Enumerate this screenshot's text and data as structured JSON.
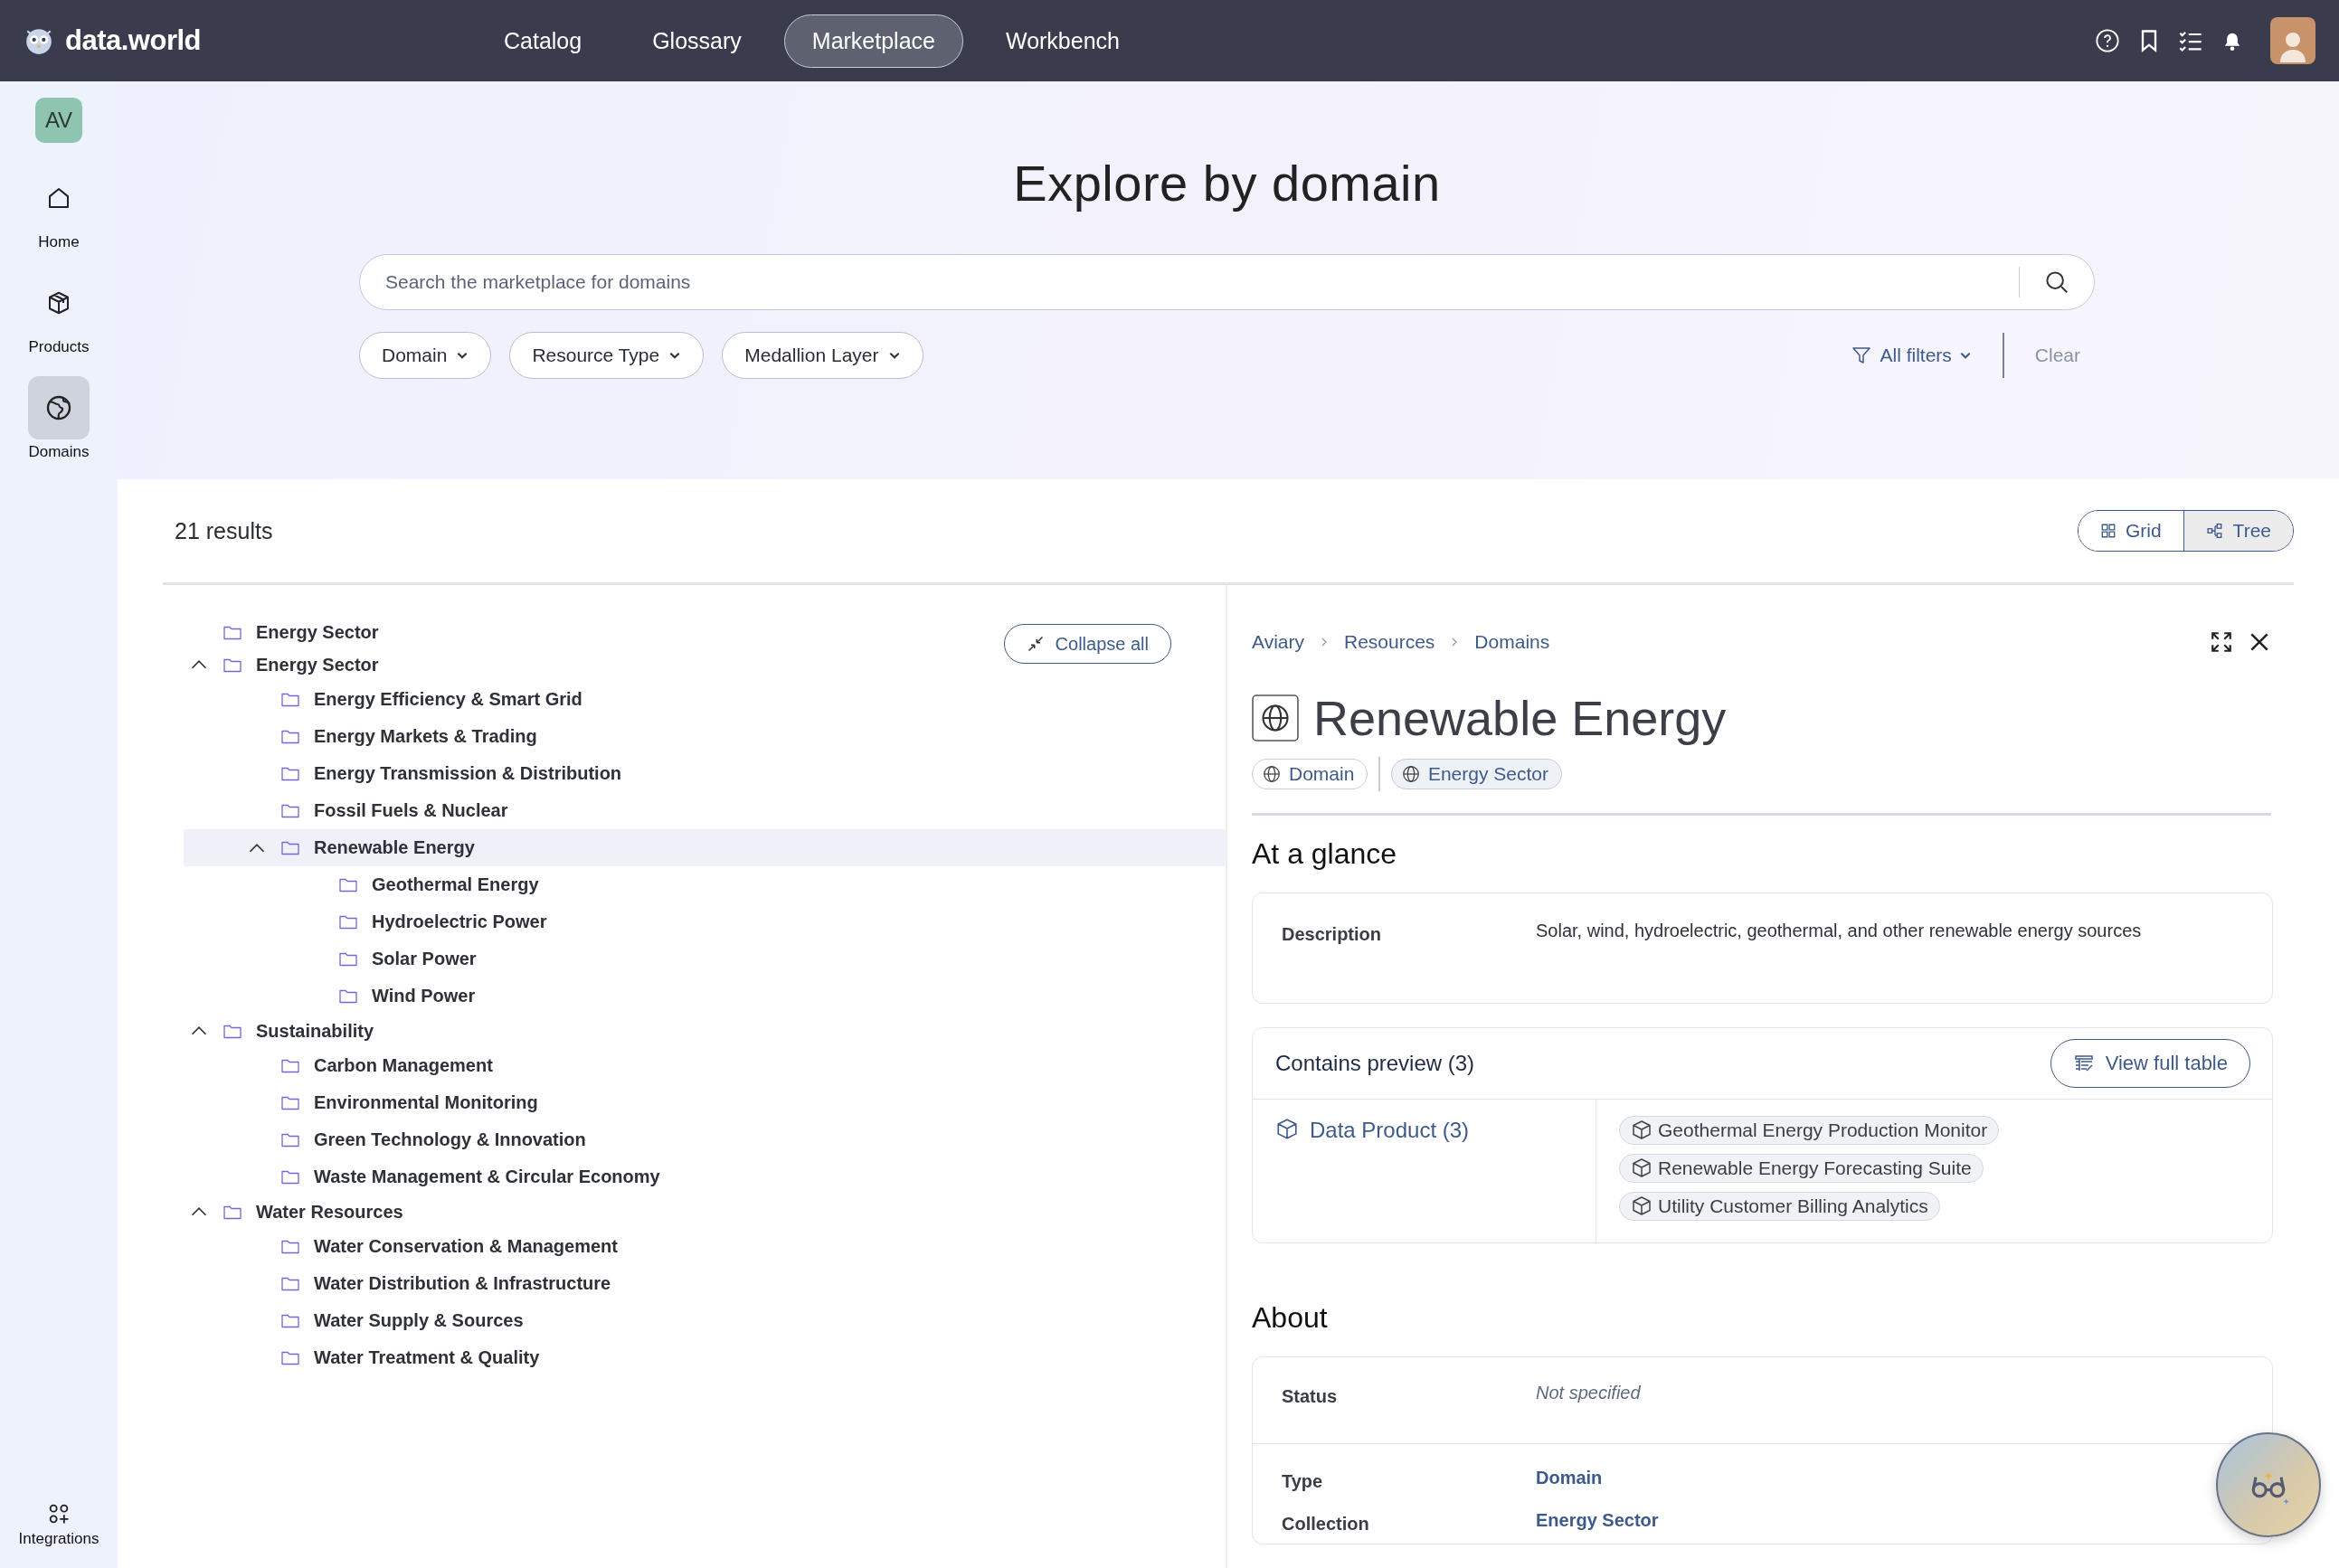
{
  "topbar": {
    "brand": "data.world",
    "nav": [
      {
        "label": "Catalog",
        "selected": false
      },
      {
        "label": "Glossary",
        "selected": false
      },
      {
        "label": "Marketplace",
        "selected": true
      },
      {
        "label": "Workbench",
        "selected": false
      }
    ]
  },
  "sidebar": {
    "badge": "AV",
    "items": [
      {
        "label": "Home",
        "selected": false
      },
      {
        "label": "Products",
        "selected": false
      },
      {
        "label": "Domains",
        "selected": true
      }
    ],
    "footer_item": {
      "label": "Integrations"
    }
  },
  "hero": {
    "title": "Explore by domain",
    "search": {
      "placeholder": "Search the marketplace for domains"
    },
    "filters": [
      "Domain",
      "Resource Type",
      "Medallion Layer"
    ],
    "all_filters": "All filters",
    "clear": "Clear"
  },
  "results": {
    "count": "21 results",
    "views": [
      {
        "label": "Grid",
        "selected": false
      },
      {
        "label": "Tree",
        "selected": true
      }
    ]
  },
  "tree": {
    "collapse_button": "Collapse all",
    "nodes": [
      {
        "label": "Energy Sector",
        "selected": false
      },
      {
        "label": "Energy Sector",
        "selected": false,
        "expanded": true,
        "children": [
          {
            "label": "Energy Efficiency & Smart Grid",
            "selected": false
          },
          {
            "label": "Energy Markets & Trading",
            "selected": false
          },
          {
            "label": "Energy Transmission & Distribution",
            "selected": false
          },
          {
            "label": "Fossil Fuels & Nuclear",
            "selected": false
          },
          {
            "label": "Renewable Energy",
            "selected": true,
            "expanded": true,
            "children": [
              {
                "label": "Geothermal Energy",
                "selected": false
              },
              {
                "label": "Hydroelectric Power",
                "selected": false
              },
              {
                "label": "Solar Power",
                "selected": false
              },
              {
                "label": "Wind Power",
                "selected": false
              }
            ]
          }
        ]
      },
      {
        "label": "Sustainability",
        "selected": false,
        "expanded": true,
        "children": [
          {
            "label": "Carbon Management",
            "selected": false
          },
          {
            "label": "Environmental Monitoring",
            "selected": false
          },
          {
            "label": "Green Technology & Innovation",
            "selected": false
          },
          {
            "label": "Waste Management & Circular Economy",
            "selected": false
          }
        ]
      },
      {
        "label": "Water Resources",
        "selected": false,
        "expanded": true,
        "children": [
          {
            "label": "Water Conservation & Management",
            "selected": false
          },
          {
            "label": "Water Distribution & Infrastructure",
            "selected": false
          },
          {
            "label": "Water Supply & Sources",
            "selected": false
          },
          {
            "label": "Water Treatment & Quality",
            "selected": false
          }
        ]
      }
    ]
  },
  "detail": {
    "breadcrumb": [
      "Aviary",
      "Resources",
      "Domains"
    ],
    "title": "Renewable Energy",
    "tags": [
      "Domain",
      "Energy Sector"
    ],
    "at_a_glance": {
      "heading": "At a glance",
      "rows": [
        {
          "label": "Description",
          "value": "Solar, wind, hydroelectric, geothermal, and other renewable energy sources"
        }
      ]
    },
    "contains_preview": {
      "title": "Contains preview (3)",
      "button": "View full table",
      "category": "Data Product (3)",
      "items": [
        "Geothermal Energy Production Monitor",
        "Renewable Energy Forecasting Suite",
        "Utility Customer Billing Analytics"
      ]
    },
    "about": {
      "heading": "About",
      "rows": [
        {
          "label": "Status",
          "value": "Not specified",
          "kind": "empty"
        },
        {
          "label": "Type",
          "value": "Domain",
          "kind": "link"
        },
        {
          "label": "Collection",
          "value": "Energy Sector",
          "kind": "link"
        }
      ]
    }
  }
}
